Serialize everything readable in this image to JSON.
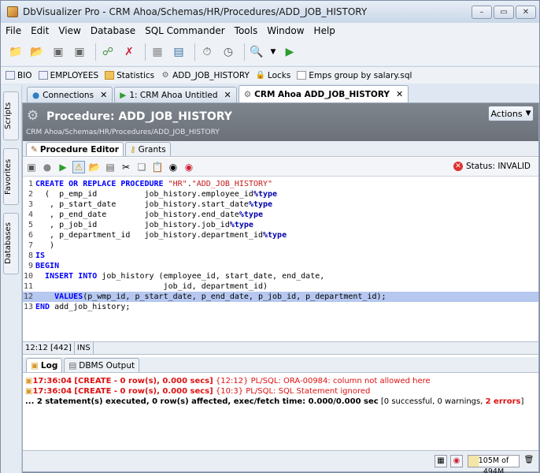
{
  "window": {
    "title": "DbVisualizer Pro - CRM Ahoa/Schemas/HR/Procedures/ADD_JOB_HISTORY",
    "buttons": [
      "–",
      "▭",
      "✕"
    ]
  },
  "menu": [
    "File",
    "Edit",
    "View",
    "Database",
    "SQL Commander",
    "Tools",
    "Window",
    "Help"
  ],
  "favorites": [
    {
      "icon": "table-icon",
      "label": "BIO"
    },
    {
      "icon": "table-icon",
      "label": "EMPLOYEES"
    },
    {
      "icon": "folder-icon",
      "label": "Statistics"
    },
    {
      "icon": "procedure-icon",
      "label": "ADD_JOB_HISTORY"
    },
    {
      "icon": "lock-icon",
      "label": "Locks"
    },
    {
      "icon": "sql-file-icon",
      "label": "Emps group by salary.sql"
    }
  ],
  "side_tabs": [
    "Scripts",
    "Favorites",
    "Databases"
  ],
  "editor_tabs": [
    {
      "label": "Connections",
      "active": false
    },
    {
      "label": "1: CRM Ahoa Untitled",
      "active": false
    },
    {
      "label": "CRM Ahoa ADD_JOB_HISTORY",
      "active": true
    }
  ],
  "header": {
    "title": "Procedure: ADD_JOB_HISTORY",
    "path": "CRM Ahoa/Schemas/HR/Procedures/ADD_JOB_HISTORY",
    "actions_label": "Actions"
  },
  "sub_tabs": [
    {
      "label": "Procedure Editor",
      "active": true
    },
    {
      "label": "Grants",
      "active": false
    }
  ],
  "status": {
    "label": "Status: INVALID",
    "color": "#d33333"
  },
  "code_lines": [
    {
      "n": "1",
      "html": "<span class='kw'>CREATE OR REPLACE PROCEDURE</span> <span class='str'>\"HR\"</span>.<span class='str'>\"ADD_JOB_HISTORY\"</span>"
    },
    {
      "n": "2",
      "html": "  (  p_emp_id          job_history.employee_id<span class='typ'>%type</span>"
    },
    {
      "n": "3",
      "html": "   , p_start_date      job_history.start_date<span class='typ'>%type</span>"
    },
    {
      "n": "4",
      "html": "   , p_end_date        job_history.end_date<span class='typ'>%type</span>"
    },
    {
      "n": "5",
      "html": "   , p_job_id          job_history.job_id<span class='typ'>%type</span>"
    },
    {
      "n": "6",
      "html": "   , p_department_id   job_history.department_id<span class='typ'>%type</span>"
    },
    {
      "n": "7",
      "html": "   )"
    },
    {
      "n": "8",
      "html": "<span class='kw'>IS</span>"
    },
    {
      "n": "9",
      "html": "<span class='kw'>BEGIN</span>"
    },
    {
      "n": "10",
      "html": "  <span class='kw'>INSERT INTO</span> job_history (employee_id, start_date, end_date,"
    },
    {
      "n": "11",
      "html": "                           job_id, department_id)"
    },
    {
      "n": "12",
      "html": "    <span class='kw'>VALUES</span>(p_wmp_id, p_start_date, p_end_date, p_job_id, p_department_id);"
    },
    {
      "n": "13",
      "html": "<span class='kw'>END</span> add_job_history;"
    }
  ],
  "highlight_line": "12",
  "caret": {
    "position": "12:12 [442]",
    "mode": "INS"
  },
  "log_tabs": [
    {
      "label": "Log",
      "active": true
    },
    {
      "label": "DBMS Output",
      "active": false
    }
  ],
  "log": [
    {
      "time": "17:36:04",
      "status": "[CREATE - 0 row(s), 0.000 secs]",
      "pos": "{12:12}",
      "msg": "PL/SQL: ORA-00984: column not allowed here"
    },
    {
      "time": "17:36:04",
      "status": "[CREATE - 0 row(s), 0.000 secs]",
      "pos": "{10:3}",
      "msg": "PL/SQL: SQL Statement ignored"
    }
  ],
  "summary": {
    "main": "... 2 statement(s) executed, 0 row(s) affected, exec/fetch time: 0.000/0.000 sec",
    "detail": "[0 successful, 0 warnings,",
    "errors": "2 errors",
    "close": "]"
  },
  "memory": {
    "label": "105M of 494M",
    "used_fraction": 0.21
  }
}
